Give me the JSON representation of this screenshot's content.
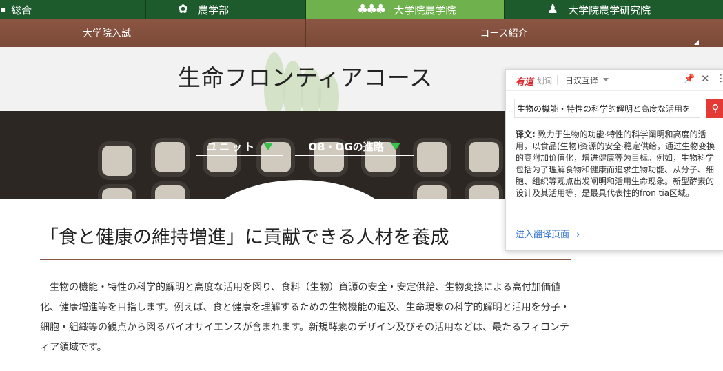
{
  "topnav": {
    "tabs": [
      {
        "label": "総合",
        "icon": "leaf-icon"
      },
      {
        "label": "農学部",
        "icon": "clover-icon"
      },
      {
        "label": "大学院農学院",
        "icon": "plants-icon"
      },
      {
        "label": "大学院農学研究院",
        "icon": "person-icon"
      }
    ],
    "active_index": 2
  },
  "subnav": {
    "items": [
      "大学院入試",
      "コース紹介"
    ]
  },
  "page_title": "生命フロンティアコース",
  "photo_links": [
    {
      "label": "ユニット"
    },
    {
      "label": "OB・OGの進路"
    }
  ],
  "main": {
    "headline": "「食と健康の維持増進」に貢献できる人材を養成",
    "paragraph": "生物の機能・特性の科学的解明と高度な活用を図り、食料（生物）資源の安全・安定供給、生物変換による高付加価値化、健康増進等を目指します。例えば、食と健康を理解するための生物機能の追及、生命現象の科学的解明と活用を分子・細胞・組織等の観点から図るバイオサイエンスが含まれます。新規酵素のデザイン及びその活用などは、最たるフィロンティア領域です。"
  },
  "popup": {
    "logo": "有道",
    "logo_sub": "划词",
    "mode": "日汉互译",
    "query": "生物の機能・特性の科学的解明と高度な活用を",
    "translation_label": "译文:",
    "translation": "致力于生物的功能·特性的科学阐明和高度的活用，以食品(生物)资源的安全·稳定供给，通过生物变换的高附加价值化，增进健康等为目标。例如，生物科学包括为了理解食物和健康而追求生物功能、从分子、细胞、组织等观点出发阐明和活用生命现象。新型酵素的设计及其活用等，是最具代表性的fron tia区域。",
    "link": "进入翻译页面"
  },
  "colors": {
    "nav_green": "#1d5b2c",
    "nav_active": "#6fb14d",
    "subnav_brown": "#7c4a38",
    "accent_triangle": "#35c24a",
    "popup_red": "#e43a36",
    "link_blue": "#2d6fcb"
  }
}
